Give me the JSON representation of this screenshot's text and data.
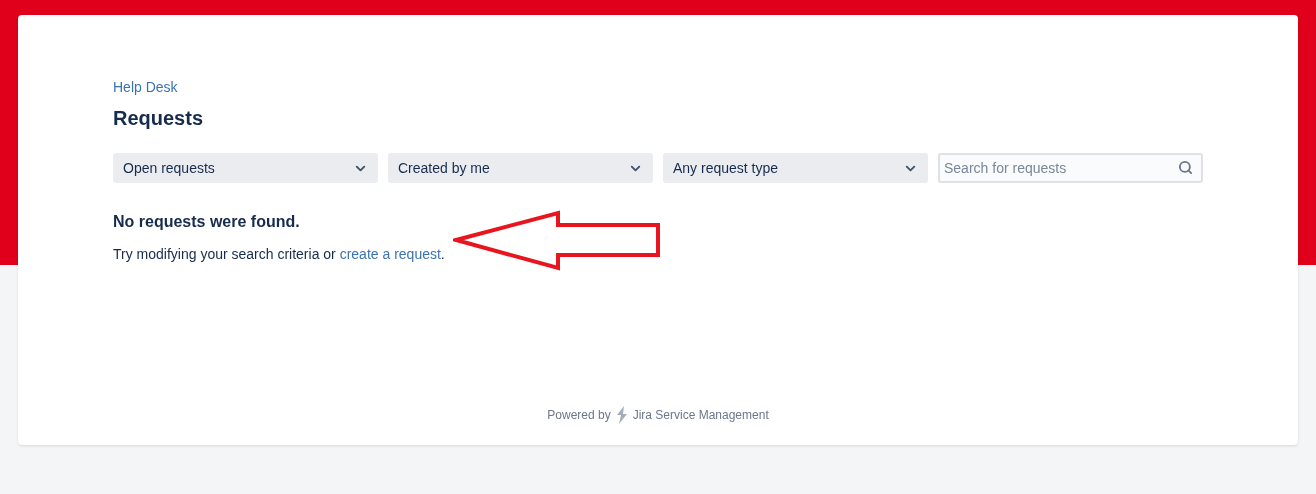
{
  "breadcrumb": "Help Desk",
  "title": "Requests",
  "filters": [
    {
      "label": "Open requests"
    },
    {
      "label": "Created by me"
    },
    {
      "label": "Any request type"
    }
  ],
  "search": {
    "placeholder": "Search for requests"
  },
  "empty_state": {
    "heading": "No requests were found.",
    "text_before": "Try modifying your search criteria or ",
    "link": "create a request",
    "text_after": "."
  },
  "footer": {
    "prefix": "Powered by",
    "product": "Jira Service Management"
  }
}
